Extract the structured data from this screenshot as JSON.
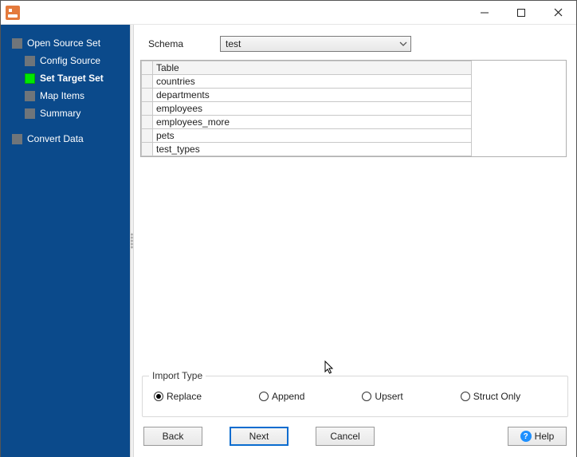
{
  "sidebar": {
    "root": "Open Source Set",
    "items": [
      {
        "label": "Config Source",
        "active": false
      },
      {
        "label": "Set Target Set",
        "active": true
      },
      {
        "label": "Map Items",
        "active": false
      },
      {
        "label": "Summary",
        "active": false
      }
    ],
    "footer": "Convert Data"
  },
  "schema": {
    "label": "Schema",
    "value": "test"
  },
  "table": {
    "header": "Table",
    "rows": [
      "countries",
      "departments",
      "employees",
      "employees_more",
      "pets",
      "test_types"
    ]
  },
  "import": {
    "legend": "Import Type",
    "options": [
      "Replace",
      "Append",
      "Upsert",
      "Struct Only"
    ],
    "selected": 0
  },
  "buttons": {
    "back": "Back",
    "next": "Next",
    "cancel": "Cancel",
    "help": "Help"
  }
}
